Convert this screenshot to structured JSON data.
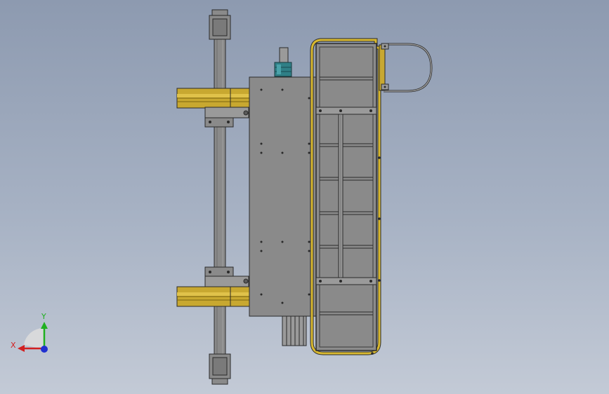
{
  "view": {
    "type": "cad-model-top-view",
    "background_top": "#8d9ab0",
    "background_bottom": "#c3cad6"
  },
  "colors": {
    "steel": "#8a8a8a",
    "steel_dark": "#6e6e6e",
    "steel_light": "#a0a0a0",
    "outline": "#2a2a2a",
    "rail_yellow": "#c8a830",
    "rail_yellow_dark": "#7a6410",
    "motor_blue": "#2f7f86",
    "axis_x": "#d22020",
    "axis_y": "#20b020",
    "axis_z": "#2030d0"
  },
  "triad": {
    "x_label": "X",
    "y_label": "Y",
    "icon": "coordinate-axes-icon"
  }
}
